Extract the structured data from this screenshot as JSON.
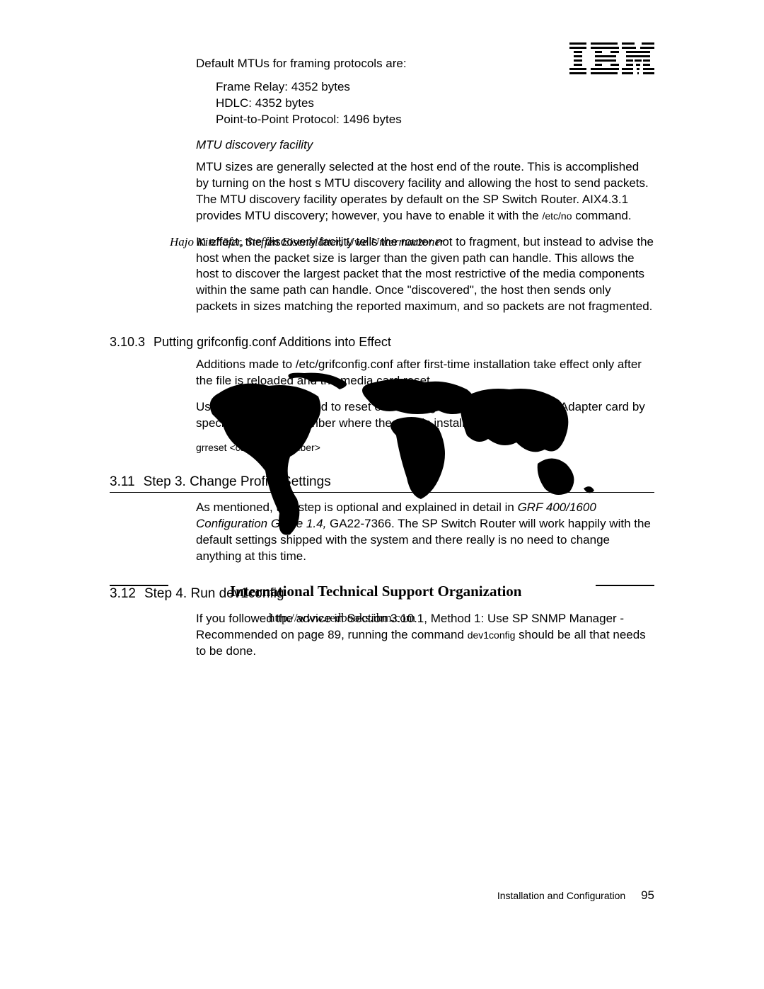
{
  "logo_name": "ibm-logo",
  "intro": "Default MTUs for framing protocols are:",
  "bullets": {
    "b1": "Frame Relay: 4352 bytes",
    "b2": "HDLC: 4352 bytes",
    "b3": "Point-to-Point Protocol: 1496 bytes"
  },
  "mtu_heading": "MTU discovery facility",
  "mtu_para1_a": "MTU sizes are generally selected at the host end of the route. This is accomplished by turning on the host s MTU discovery facility and allowing the host to send packets. The MTU discovery facility operates by default on the SP Switch Router. AIX4.3.1 provides MTU discovery; however, you have to enable it with the ",
  "mtu_para1_cmd": "/etc/no",
  "mtu_para1_b": "    command.",
  "authors_overlay": "Hajo Kitzhöfer, Steffen Eisenblätter, Uwe Untermarzoner",
  "mtu_para2": "In effect, the discovery facility tells the router not to fragment, but instead to advise the host when the packet size is larger than the given path can handle. This allows the host to discover the largest packet that the most restrictive of the media components within the same path can handle. Once \"discovered\", the host then sends only packets in sizes matching the reported maximum, and so packets are not fragmented.",
  "sec3103": {
    "num": "3.10.3",
    "title": "Putting grifconfig.conf Additions into Effect",
    "p1": "Additions made to /etc/grifconfig.conf after first-time installation take effect only after the file is reloaded and the media card reset.",
    "p2_a": "Use the ",
    "p2_cmd": "grreset",
    "p2_b": " command to reset each configured SP Switch Router Adapter card by specifying the slot number where the card is installed, as follows:",
    "code": "grreset <card_slot_number>"
  },
  "sec311": {
    "num": "3.11",
    "title": "Step 3. Change Profile Settings",
    "p_a": "As mentioned, this step is optional and explained in detail in ",
    "p_i": "GRF 400/1600 Configuration Guide 1.4,",
    "p_b": " GA22-7366. The SP Switch Router will work happily with the default settings shipped with the system and there really is no need to change anything at this time."
  },
  "overlay_bold": "International Technical Support Organization",
  "overlay_url": "http://www.redbooks.ibm.com",
  "sec312": {
    "num": "3.12",
    "title": "Step 4. Run dev1config",
    "p_a": "If you followed the advice in Section 3.10.1, Method 1: Use SP SNMP Manager - Recommended  on page 89, running the command ",
    "p_cmd": "dev1config",
    "p_b": " should be all that needs to be done."
  },
  "footer": {
    "label": "Installation and Configuration",
    "page": "95"
  }
}
